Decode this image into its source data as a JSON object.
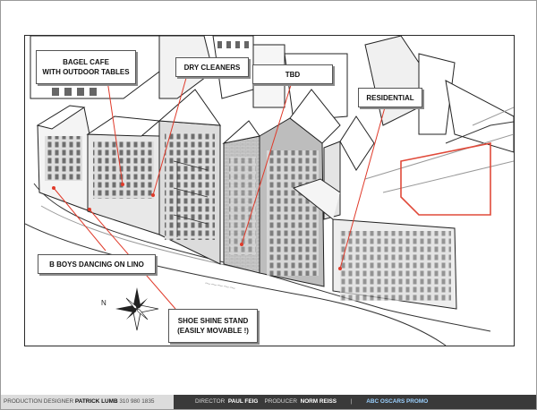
{
  "callouts": {
    "bagel": {
      "line1": "BAGEL CAFE",
      "line2": "WITH OUTDOOR TABLES"
    },
    "dry_cleaners": "DRY CLEANERS",
    "tbd": "TBD",
    "residential": "RESIDENTIAL",
    "b_boys": "B BOYS DANCING ON LINO",
    "shoe_shine": {
      "line1": "SHOE SHINE STAND",
      "line2": "(EASILY MOVABLE !)"
    }
  },
  "compass": {
    "north_label": "N"
  },
  "footer": {
    "designer_role": "PRODUCTION DESIGNER",
    "designer_name": "PATRICK LUMB",
    "designer_phone": "310 980 1835",
    "director_role": "DIRECTOR",
    "director_name": "PAUL FEIG",
    "producer_role": "PRODUCER",
    "producer_name": "NORM REISS",
    "separator": "|",
    "project": "ABC OSCARS PROMO"
  },
  "colors": {
    "leader_line": "#e03a2a",
    "footer_dark": "#3a3a3a",
    "footer_light": "#dcdcdc",
    "promo_text": "#9ad0ff"
  }
}
